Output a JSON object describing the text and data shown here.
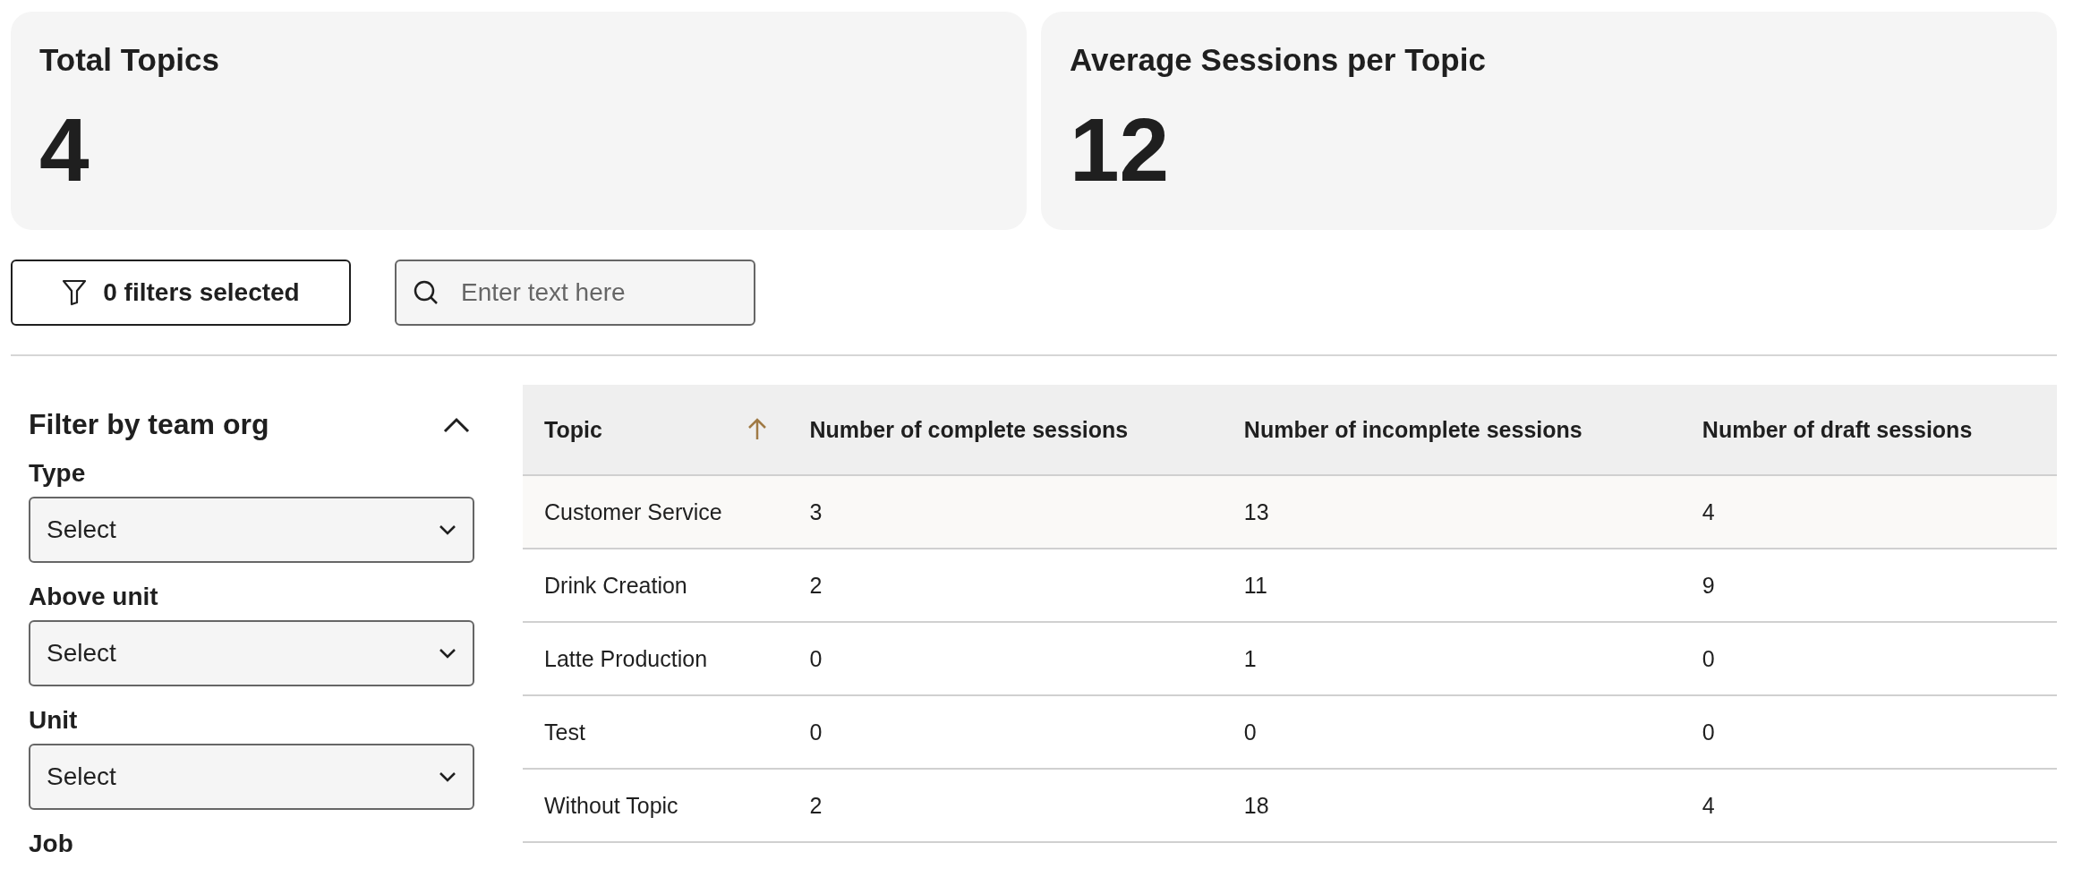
{
  "stats": [
    {
      "title": "Total Topics",
      "value": "4"
    },
    {
      "title": "Average Sessions per Topic",
      "value": "12"
    }
  ],
  "filter_button": {
    "label": "0 filters selected"
  },
  "search": {
    "placeholder": "Enter text here"
  },
  "sidebar": {
    "title": "Filter by team org",
    "expanded": true,
    "filters": [
      {
        "label": "Type",
        "value": "Select"
      },
      {
        "label": "Above unit",
        "value": "Select"
      },
      {
        "label": "Unit",
        "value": "Select"
      }
    ],
    "next_label": "Job"
  },
  "table": {
    "columns": [
      {
        "label": "Topic",
        "sorted": true
      },
      {
        "label": "Number of complete sessions",
        "sorted": false
      },
      {
        "label": "Number of incomplete sessions",
        "sorted": false
      },
      {
        "label": "Number of draft sessions",
        "sorted": false
      }
    ],
    "rows": [
      {
        "cells": [
          "Customer Service",
          "3",
          "13",
          "4"
        ],
        "highlighted": true
      },
      {
        "cells": [
          "Drink Creation",
          "2",
          "11",
          "9"
        ],
        "highlighted": false
      },
      {
        "cells": [
          "Latte Production",
          "0",
          "1",
          "0"
        ],
        "highlighted": false
      },
      {
        "cells": [
          "Test",
          "0",
          "0",
          "0"
        ],
        "highlighted": false
      },
      {
        "cells": [
          "Without Topic",
          "2",
          "18",
          "4"
        ],
        "highlighted": false
      }
    ]
  }
}
